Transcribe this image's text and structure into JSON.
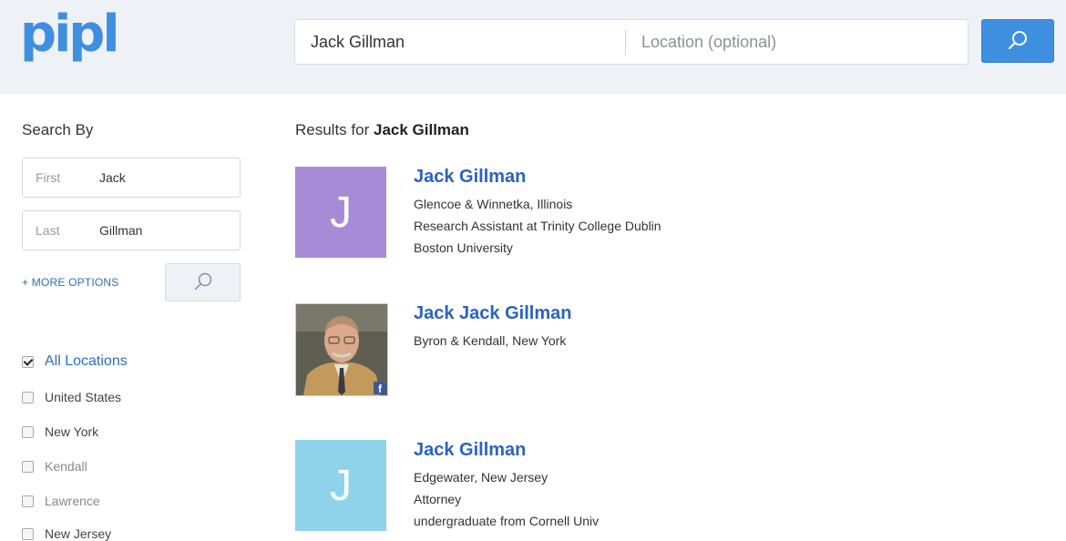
{
  "header": {
    "logo": "pipl",
    "search_name_value": "Jack Gillman",
    "search_location_placeholder": "Location (optional)"
  },
  "sidebar": {
    "title": "Search By",
    "first_label": "First",
    "first_value": "Jack",
    "last_label": "Last",
    "last_value": "Gillman",
    "more_options": "+ MORE OPTIONS",
    "locations": [
      {
        "label": "All Locations",
        "checked": true
      },
      {
        "label": "United States",
        "checked": false
      },
      {
        "label": "New York",
        "checked": false
      },
      {
        "label": "Kendall",
        "checked": false
      },
      {
        "label": "Lawrence",
        "checked": false
      },
      {
        "label": "New Jersey",
        "checked": false
      }
    ]
  },
  "results": {
    "prefix": "Results for ",
    "query": "Jack Gillman",
    "items": [
      {
        "avatar_letter": "J",
        "avatar_color": "#a78bd6",
        "name": "Jack Gillman",
        "lines": [
          "Glencoe & Winnetka, Illinois",
          "Research Assistant at Trinity College Dublin",
          "Boston University"
        ]
      },
      {
        "avatar_letter": "",
        "avatar_type": "photo",
        "badge": "f",
        "name": "Jack Jack Gillman",
        "lines": [
          "Byron & Kendall, New York"
        ]
      },
      {
        "avatar_letter": "J",
        "avatar_color": "#8fd3ea",
        "name": "Jack Gillman",
        "lines": [
          "Edgewater, New Jersey",
          "Attorney",
          "undergraduate from Cornell Univ"
        ]
      }
    ]
  },
  "colors": {
    "brand": "#3f8fe0",
    "link": "#2a63c2",
    "header_bg": "#eef1f6"
  }
}
